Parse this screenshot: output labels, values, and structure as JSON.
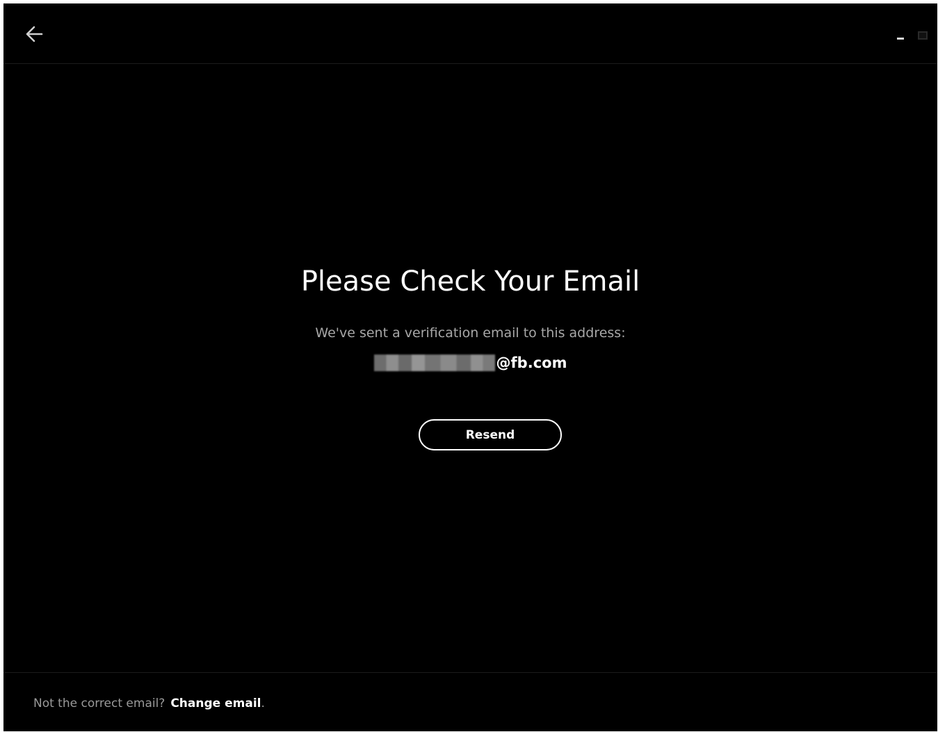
{
  "header": {
    "back_icon": "arrow-left-icon",
    "minimize_icon": "minimize-icon",
    "maximize_icon": "maximize-icon"
  },
  "main": {
    "title": "Please Check Your Email",
    "subtitle": "We've sent a verification email to this address:",
    "email_domain": "@fb.com",
    "resend_label": "Resend"
  },
  "footer": {
    "prompt": "Not the correct email?",
    "change_link": "Change email",
    "period": "."
  },
  "colors": {
    "background": "#000000",
    "text_primary": "#ffffff",
    "text_secondary": "#a8a8a8"
  }
}
